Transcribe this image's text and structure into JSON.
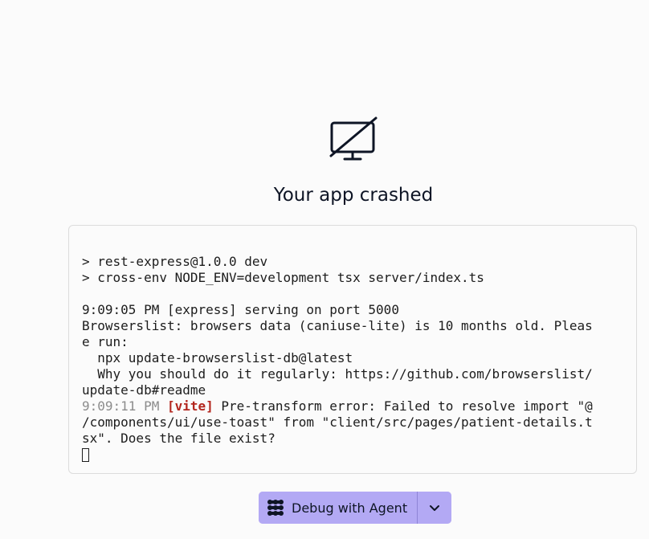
{
  "crash": {
    "icon": "monitor-off-icon",
    "title": "Your app crashed"
  },
  "console": {
    "lines": [
      {
        "text": "> rest-express@1.0.0 dev"
      },
      {
        "text": "> cross-env NODE_ENV=development tsx server/index.ts"
      },
      {
        "text": ""
      },
      {
        "text": "9:09:05 PM [express] serving on port 5000"
      },
      {
        "text": "Browserslist: browsers data (caniuse-lite) is 10 months old. Pleas"
      },
      {
        "text": "e run:"
      },
      {
        "text": "  npx update-browserslist-db@latest"
      },
      {
        "text": "  Why you should do it regularly: https://github.com/browserslist/"
      },
      {
        "text": "update-db#readme"
      }
    ],
    "error": {
      "timestamp": "9:09:11 PM",
      "tag": "[vite]",
      "line1": " Pre-transform error: Failed to resolve import \"@",
      "line2": "/components/ui/use-toast\" from \"client/src/pages/patient-details.t",
      "line3": "sx\". Does the file exist?"
    }
  },
  "actions": {
    "debug_label": "Debug with Agent",
    "debug_icon": "agent-icon",
    "dropdown_icon": "chevron-down-icon",
    "accent_color": "#b3a9f4"
  }
}
